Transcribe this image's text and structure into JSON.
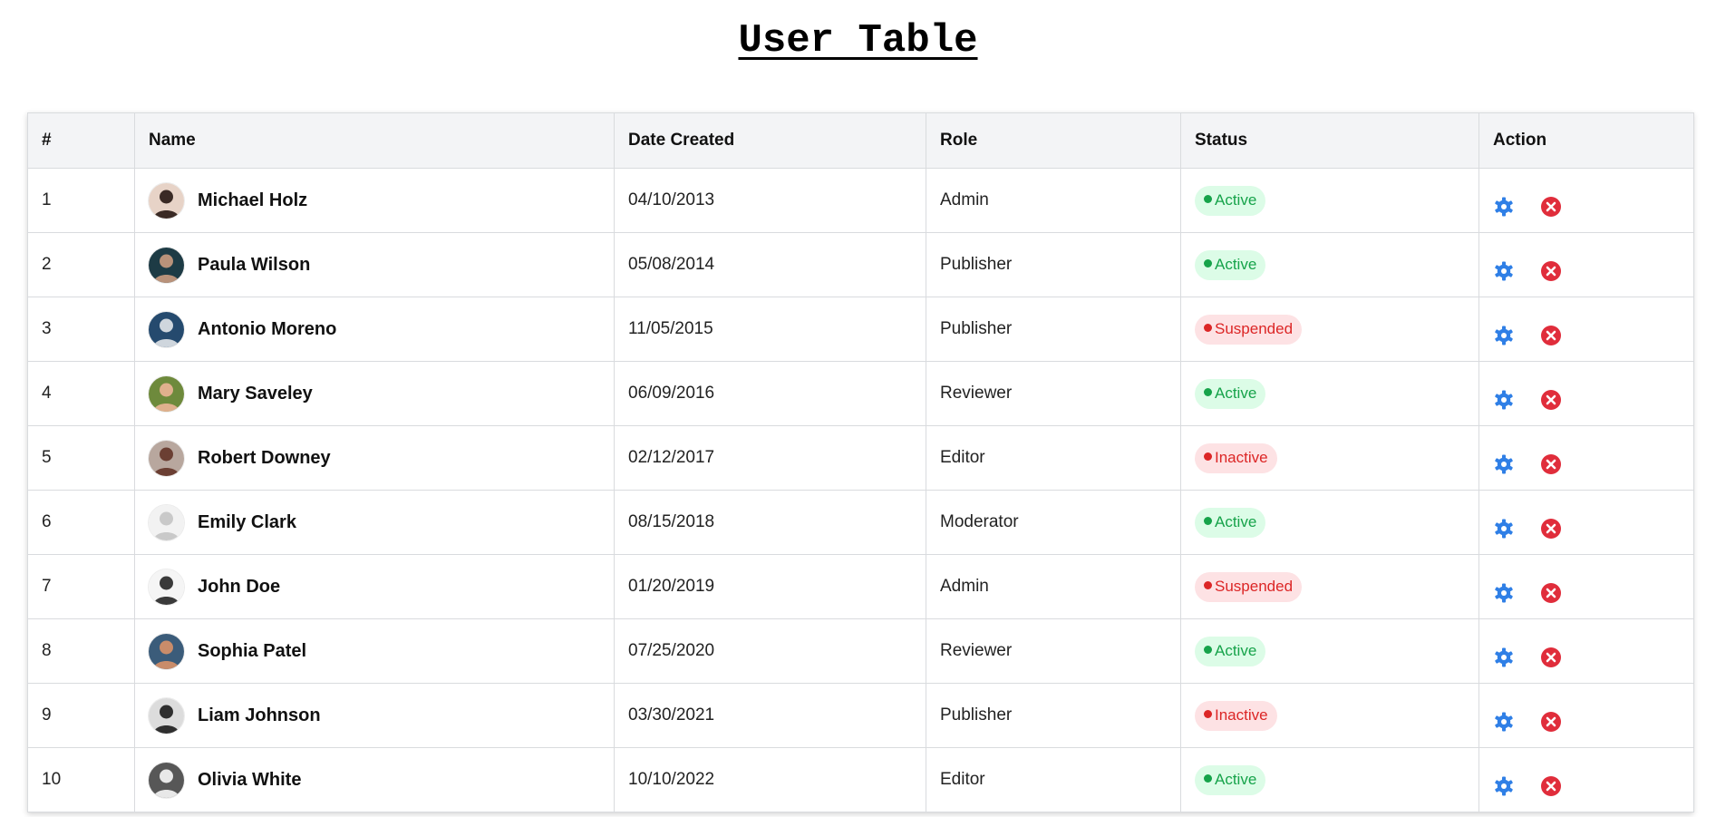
{
  "title": "User Table",
  "colors": {
    "header_bg": "#f3f4f6",
    "border": "#d9dbde",
    "active_bg": "#dcfce7",
    "active_text": "#16a34a",
    "danger_bg": "#fde2e4",
    "danger_text": "#dc2626",
    "gear_icon": "#2f7fe6",
    "delete_icon": "#e02d3b"
  },
  "table": {
    "columns": [
      "#",
      "Name",
      "Date Created",
      "Role",
      "Status",
      "Action"
    ],
    "rows": [
      {
        "id": "1",
        "name": "Michael Holz",
        "date": "04/10/2013",
        "role": "Admin",
        "status": "Active",
        "avatar_colors": [
          "#e7d3c7",
          "#3a2a25"
        ]
      },
      {
        "id": "2",
        "name": "Paula Wilson",
        "date": "05/08/2014",
        "role": "Publisher",
        "status": "Active",
        "avatar_colors": [
          "#1d3b45",
          "#b9927a"
        ]
      },
      {
        "id": "3",
        "name": "Antonio Moreno",
        "date": "11/05/2015",
        "role": "Publisher",
        "status": "Suspended",
        "avatar_colors": [
          "#254a6e",
          "#cfd6dd"
        ]
      },
      {
        "id": "4",
        "name": "Mary Saveley",
        "date": "06/09/2016",
        "role": "Reviewer",
        "status": "Active",
        "avatar_colors": [
          "#6e8a3c",
          "#e0b08d"
        ]
      },
      {
        "id": "5",
        "name": "Robert Downey",
        "date": "02/12/2017",
        "role": "Editor",
        "status": "Inactive",
        "avatar_colors": [
          "#b8a79e",
          "#6b3f33"
        ]
      },
      {
        "id": "6",
        "name": "Emily Clark",
        "date": "08/15/2018",
        "role": "Moderator",
        "status": "Active",
        "avatar_colors": [
          "#f2f2f2",
          "#c9c9c9"
        ]
      },
      {
        "id": "7",
        "name": "John Doe",
        "date": "01/20/2019",
        "role": "Admin",
        "status": "Suspended",
        "avatar_colors": [
          "#f5f5f5",
          "#3a3a3a"
        ]
      },
      {
        "id": "8",
        "name": "Sophia Patel",
        "date": "07/25/2020",
        "role": "Reviewer",
        "status": "Active",
        "avatar_colors": [
          "#3b5c7a",
          "#c98c6a"
        ]
      },
      {
        "id": "9",
        "name": "Liam Johnson",
        "date": "03/30/2021",
        "role": "Publisher",
        "status": "Inactive",
        "avatar_colors": [
          "#dcdcdc",
          "#2f2f2f"
        ]
      },
      {
        "id": "10",
        "name": "Olivia White",
        "date": "10/10/2022",
        "role": "Editor",
        "status": "Active",
        "avatar_colors": [
          "#575757",
          "#e8e8e8"
        ]
      }
    ]
  }
}
